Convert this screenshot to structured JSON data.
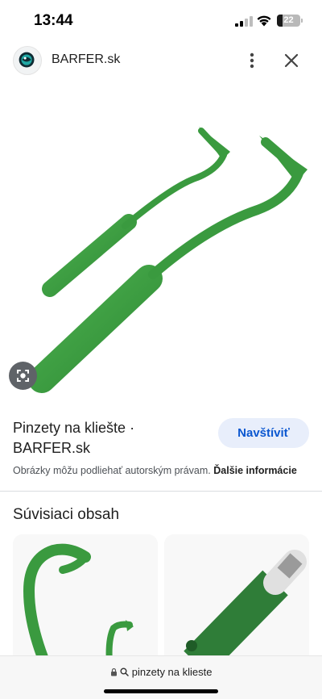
{
  "status_bar": {
    "time": "13:44",
    "battery_level": "22",
    "icons": [
      "cellular-signal-icon",
      "wifi-icon",
      "battery-icon"
    ]
  },
  "header": {
    "site_name": "BARFER.sk",
    "icons": [
      "site-logo-icon",
      "more-vertical-icon",
      "close-icon"
    ]
  },
  "result": {
    "title": "Pinzety na kliešte · BARFER.sk",
    "visit_label": "Navštíviť",
    "copyright_text": "Obrázky môžu podliehať autorským právam.",
    "more_info_label": "Ďalšie informácie"
  },
  "related": {
    "heading": "Súvisiaci obsah"
  },
  "bottom_bar": {
    "url_text": "pinzety na klieste",
    "icons": [
      "lock-icon",
      "search-icon"
    ]
  },
  "colors": {
    "accent_blue": "#0b57d0",
    "visit_button_bg": "#e8eefb",
    "product_green": "#3a9a3f"
  }
}
